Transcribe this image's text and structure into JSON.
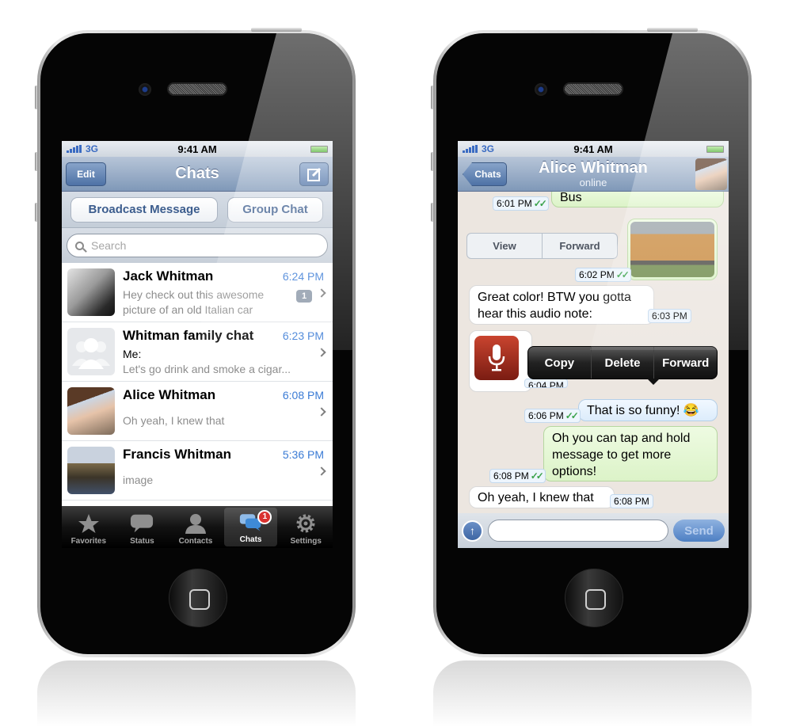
{
  "left_phone": {
    "status": {
      "network": "3G",
      "time": "9:41 AM"
    },
    "nav": {
      "edit": "Edit",
      "title": "Chats"
    },
    "actions": {
      "broadcast": "Broadcast Message",
      "group": "Group Chat"
    },
    "search": {
      "placeholder": "Search"
    },
    "chats": [
      {
        "name": "Jack Whitman",
        "time": "6:24 PM",
        "preview": "Hey check out this awesome picture of an old Italian car",
        "unread": "1"
      },
      {
        "name": "Whitman family chat",
        "time": "6:23 PM",
        "sender": "Me:",
        "preview": "Let's go drink and smoke a cigar..."
      },
      {
        "name": "Alice Whitman",
        "time": "6:08 PM",
        "preview": "Oh yeah, I knew that"
      },
      {
        "name": "Francis Whitman",
        "time": "5:36 PM",
        "preview": "image"
      }
    ],
    "tabs": [
      {
        "label": "Favorites",
        "icon": "star-icon"
      },
      {
        "label": "Status",
        "icon": "speech-bubble-icon"
      },
      {
        "label": "Contacts",
        "icon": "person-icon"
      },
      {
        "label": "Chats",
        "icon": "chats-icon",
        "badge": "1"
      },
      {
        "label": "Settings",
        "icon": "gear-icon"
      }
    ]
  },
  "right_phone": {
    "status": {
      "network": "3G",
      "time": "9:41 AM"
    },
    "nav": {
      "back": "Chats",
      "title": "Alice Whitman",
      "subtitle": "online"
    },
    "messages": [
      {
        "dir": "out",
        "text": "Bus",
        "time": "6:01 PM",
        "read": true
      },
      {
        "dir": "out",
        "type": "image",
        "time": "6:02 PM",
        "read": true
      },
      {
        "dir": "in",
        "text": "Great color! BTW you gotta hear this audio note:",
        "time": "6:03 PM"
      },
      {
        "dir": "in",
        "type": "audio",
        "time": "6:04 PM"
      },
      {
        "dir": "out",
        "text": "That is so funny! 😂",
        "time": "6:06 PM",
        "read": true
      },
      {
        "dir": "out",
        "text": "Oh you can tap and hold message to get more options!",
        "time": "6:08 PM",
        "read": true
      },
      {
        "dir": "in",
        "text": "Oh yeah, I knew that",
        "time": "6:08 PM"
      }
    ],
    "image_actions": {
      "view": "View",
      "forward": "Forward"
    },
    "popup": {
      "copy": "Copy",
      "delete": "Delete",
      "forward": "Forward"
    },
    "input": {
      "placeholder": "",
      "send": "Send"
    },
    "ticks": "✓✓"
  }
}
